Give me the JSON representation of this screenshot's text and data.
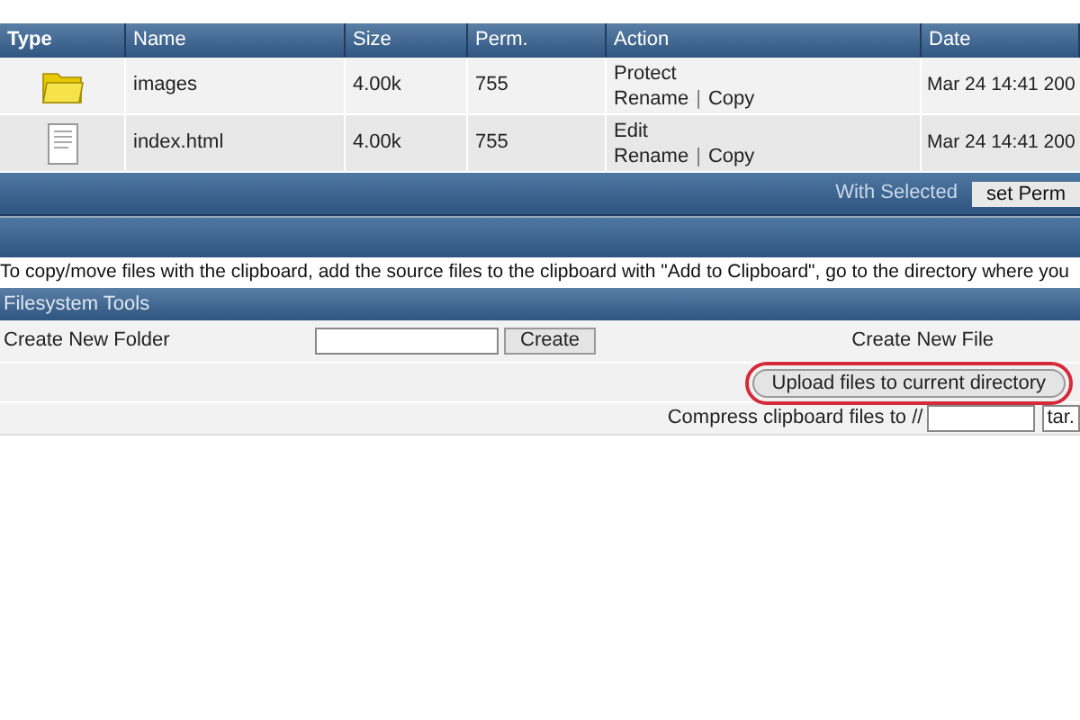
{
  "table": {
    "columns": [
      "Type",
      "Name",
      "Size",
      "Perm.",
      "Action",
      "Date"
    ],
    "rows": [
      {
        "kind": "folder",
        "name": "images",
        "size": "4.00k",
        "perm": "755",
        "actions": [
          "Protect",
          "Rename",
          "|",
          "Copy"
        ],
        "date": "Mar 24 14:41 200"
      },
      {
        "kind": "file",
        "name": "index.html",
        "size": "4.00k",
        "perm": "755",
        "actions": [
          "Edit",
          "Rename",
          "|",
          "Copy"
        ],
        "date": "Mar 24 14:41 200"
      }
    ]
  },
  "with_selected": {
    "label": "With Selected",
    "button": "set Perm"
  },
  "info": "To copy/move files with the clipboard, add the source files to the clipboard with \"Add to Clipboard\", go to the directory where you",
  "tools": {
    "title": "Filesystem Tools",
    "create_folder_label": "Create New Folder",
    "create_button": "Create",
    "create_file_label": "Create New File",
    "upload_button": {
      "label": "Upload files to current directory",
      "highlighted": true
    },
    "compress_label": "Compress clipboard files to //",
    "compress_ext": "tar."
  }
}
